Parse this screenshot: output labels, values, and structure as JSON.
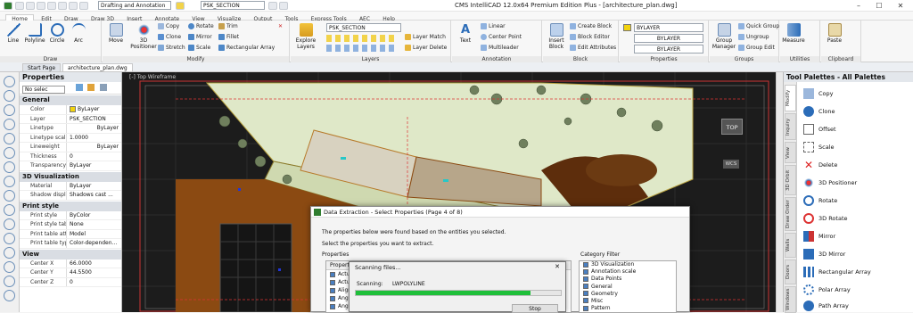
{
  "app": {
    "title": "CMS IntelliCAD 12.0x64 Premium Edition Plus - [architecture_plan.dwg]",
    "workspace": "Drafting and Annotation",
    "layer_combo": "PSK_SECTION"
  },
  "menu_tabs": [
    "Home",
    "Edit",
    "Draw",
    "Draw 3D",
    "Insert",
    "Annotate",
    "View",
    "Visualize",
    "Output",
    "Tools",
    "Express Tools",
    "AEC",
    "Help"
  ],
  "ribbon": {
    "draw": {
      "label": "Draw",
      "tools": [
        "Line",
        "Polyline",
        "Circle",
        "Arc"
      ]
    },
    "modify": {
      "label": "Modify",
      "move": "Move",
      "positioner": "3D Positioner",
      "tools": [
        "Copy",
        "Clone",
        "Stretch",
        "Rotate",
        "Mirror",
        "Scale",
        "Trim",
        "Fillet",
        "Rectangular Array"
      ]
    },
    "layers": {
      "label": "Layers",
      "explore": "Explore Layers",
      "layer_name": "PSK_SECTION",
      "match": "Layer Match",
      "delete": "Layer Delete"
    },
    "annotation": {
      "label": "Annotation",
      "text": "Text",
      "tools": [
        "Linear",
        "Center Point",
        "Multileader"
      ]
    },
    "block": {
      "label": "Block",
      "insert": "Insert Block",
      "tools": [
        "Create Block",
        "Block Editor",
        "Edit Attributes"
      ]
    },
    "properties": {
      "label": "Properties",
      "values": [
        "BYLAYER",
        "BYLAYER",
        "BYLAYER"
      ]
    },
    "groups": {
      "label": "Groups",
      "manager": "Group Manager",
      "tools": [
        "Quick Group",
        "Ungroup",
        "Group Edit"
      ]
    },
    "utilities": {
      "label": "Utilities",
      "measure": "Measure"
    },
    "clipboard": {
      "label": "Clipboard",
      "paste": "Paste"
    }
  },
  "doc_tabs": [
    "Start Page",
    "architecture_plan.dwg"
  ],
  "properties_panel": {
    "title": "Properties",
    "selection": "No selec",
    "sections": [
      {
        "name": "General",
        "rows": [
          [
            "Color",
            "ByLayer"
          ],
          [
            "Layer",
            "PSK_SECTION"
          ],
          [
            "Linetype",
            "ByLayer"
          ],
          [
            "Linetype scale",
            "1.0000"
          ],
          [
            "Lineweight",
            "ByLayer"
          ],
          [
            "Thickness",
            "0"
          ],
          [
            "Transparency",
            "ByLayer"
          ]
        ]
      },
      {
        "name": "3D Visualization",
        "rows": [
          [
            "Material",
            "ByLayer"
          ],
          [
            "Shadow display",
            "Shadows cast ..."
          ]
        ]
      },
      {
        "name": "Print style",
        "rows": [
          [
            "Print style",
            "ByColor"
          ],
          [
            "Print style table",
            "None"
          ],
          [
            "Print table attac...",
            "Model"
          ],
          [
            "Print table type",
            "Color-dependen..."
          ]
        ]
      },
      {
        "name": "View",
        "rows": [
          [
            "Center X",
            "66.0000"
          ],
          [
            "Center Y",
            "44.5500"
          ],
          [
            "Center Z",
            "0"
          ]
        ]
      }
    ]
  },
  "canvas": {
    "viewcube_label": "TOP",
    "wcs_label": "WCS",
    "viewport_label": "[-] Top Wireframe"
  },
  "tool_palettes": {
    "title": "Tool Palettes - All Palettes",
    "side_tabs": [
      "Modify",
      "Inquiry",
      "View",
      "3D Orbit",
      "Draw Order",
      "Walls",
      "Doors",
      "Windows"
    ],
    "items": [
      "Copy",
      "Clone",
      "Offset",
      "Scale",
      "Delete",
      "3D Positioner",
      "Rotate",
      "3D Rotate",
      "Mirror",
      "3D Mirror",
      "Rectangular Array",
      "Polar Array",
      "Path Array"
    ]
  },
  "dialog": {
    "title": "Data Extraction - Select Properties (Page 4 of 8)",
    "line1": "The properties below were found based on the entities you selected.",
    "line2": "Select the properties you want to extract.",
    "properties_label": "Properties",
    "category_label": "Category Filter",
    "property_items": [
      "Property",
      "Actu...",
      "Actu...",
      "Align...",
      "Angle",
      "Angle",
      "Annot..."
    ],
    "categories": [
      "3D Visualization",
      "Annotation scale",
      "Data Points",
      "General",
      "Geometry",
      "Misc",
      "Pattern"
    ]
  },
  "scan_dialog": {
    "title": "Scanning files...",
    "scanning_label": "Scanning:",
    "scanning_value": "LWPOLYLINE",
    "progress": 0.85,
    "stop": "Stop"
  },
  "colors": {
    "accent": "#2b6cb8",
    "progress": "#1fbf3a",
    "canvas": "#1c1c1c",
    "site_fill": "#dfe8c8",
    "building": "#8b4a12"
  }
}
